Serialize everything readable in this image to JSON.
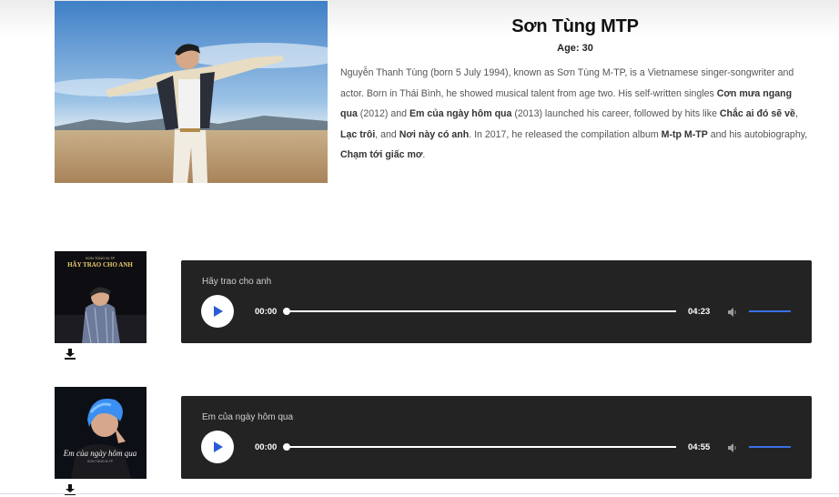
{
  "artist": {
    "name": "Sơn Tùng MTP",
    "age": "Age: 30",
    "bio": [
      {
        "t": "Nguyễn Thanh Tùng (born 5 July 1994), known as Sơn Tùng M-TP, is a Vietnamese singer-songwriter and actor. Born in Thái Bình, he showed musical talent from age two. His self-written singles ",
        "b": false
      },
      {
        "t": "Cơn mưa ngang qua",
        "b": true
      },
      {
        "t": " (2012) and ",
        "b": false
      },
      {
        "t": "Em của ngày hôm qua",
        "b": true
      },
      {
        "t": " (2013) launched his career, followed by hits like ",
        "b": false
      },
      {
        "t": "Chắc ai đó sẽ về",
        "b": true
      },
      {
        "t": ", ",
        "b": false
      },
      {
        "t": "Lạc trôi",
        "b": true
      },
      {
        "t": ", and ",
        "b": false
      },
      {
        "t": "Nơi này có anh",
        "b": true
      },
      {
        "t": ". In 2017, he released the compilation album ",
        "b": false
      },
      {
        "t": "M-tp M-TP",
        "b": true
      },
      {
        "t": " and his autobiography, ",
        "b": false
      },
      {
        "t": "Chạm tới giấc mơ",
        "b": true
      },
      {
        "t": ".",
        "b": false
      }
    ]
  },
  "tracks": [
    {
      "title": "Hãy trao cho anh",
      "current_time": "00:00",
      "duration": "04:23",
      "cover_text": "HÃY TRAO CHO ANH",
      "cover_small": "SƠN TÙNG M-TP",
      "progress": 0,
      "volume": 1.0
    },
    {
      "title": "Em của ngày hôm qua",
      "current_time": "00:00",
      "duration": "04:55",
      "cover_text": "Em của ngày hôm qua",
      "cover_small": "SƠN TÙNG M-TP",
      "progress": 0,
      "volume": 1.0
    }
  ],
  "icons": {
    "play": "play-icon",
    "volume": "volume-icon",
    "download": "download-icon"
  },
  "colors": {
    "player_bg": "#232323",
    "volume_accent": "#3b6fe6",
    "play_accent": "#2a5bd7"
  }
}
